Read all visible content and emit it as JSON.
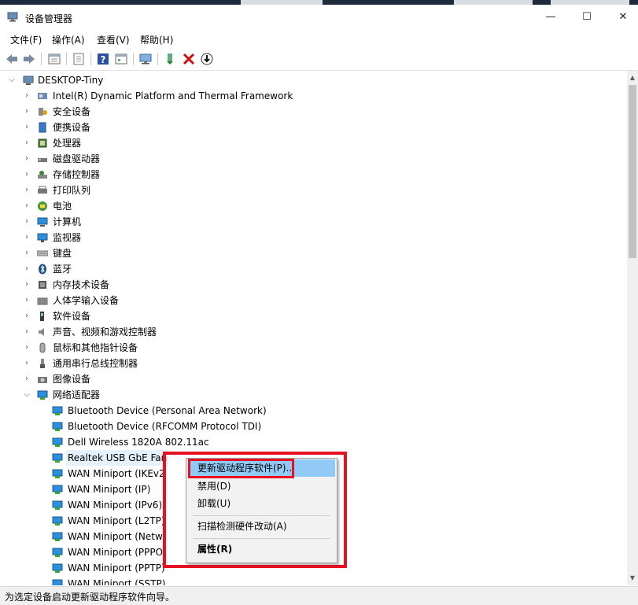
{
  "window": {
    "title": "设备管理器",
    "minimize": "—",
    "maximize": "☐",
    "close": "✕"
  },
  "menu": [
    "文件(F)",
    "操作(A)",
    "查看(V)",
    "帮助(H)"
  ],
  "toolbar": [
    "back-icon",
    "forward-icon",
    "properties-icon",
    "show-hidden-icon",
    "help-icon",
    "view-icon",
    "monitor-icon",
    "update-driver-icon",
    "uninstall-icon",
    "download-icon"
  ],
  "tree": {
    "root": "DESKTOP-Tiny",
    "categories": [
      "Intel(R) Dynamic Platform and Thermal Framework",
      "安全设备",
      "便携设备",
      "处理器",
      "磁盘驱动器",
      "存储控制器",
      "打印队列",
      "电池",
      "计算机",
      "监视器",
      "键盘",
      "蓝牙",
      "内存技术设备",
      "人体学输入设备",
      "软件设备",
      "声音、视频和游戏控制器",
      "鼠标和其他指针设备",
      "通用串行总线控制器",
      "图像设备"
    ],
    "expanded": "网络适配器",
    "network_children": [
      "Bluetooth Device (Personal Area Network)",
      "Bluetooth Device (RFCOMM Protocol TDI)",
      "Dell Wireless 1820A 802.11ac",
      "Realtek USB GbE Fan",
      "WAN Miniport (IKEv2",
      "WAN Miniport (IP)",
      "WAN Miniport (IPv6)",
      "WAN Miniport (L2TP)",
      "WAN Miniport (Netw",
      "WAN Miniport (PPPO",
      "WAN Miniport (PPTP)",
      "WAN Miniport (SSTP)"
    ]
  },
  "context_menu": {
    "update": "更新驱动程序软件(P)...",
    "disable": "禁用(D)",
    "uninstall": "卸载(U)",
    "scan": "扫描检测硬件改动(A)",
    "properties": "属性(R)"
  },
  "status": "为选定设备启动更新驱动程序软件向导。"
}
